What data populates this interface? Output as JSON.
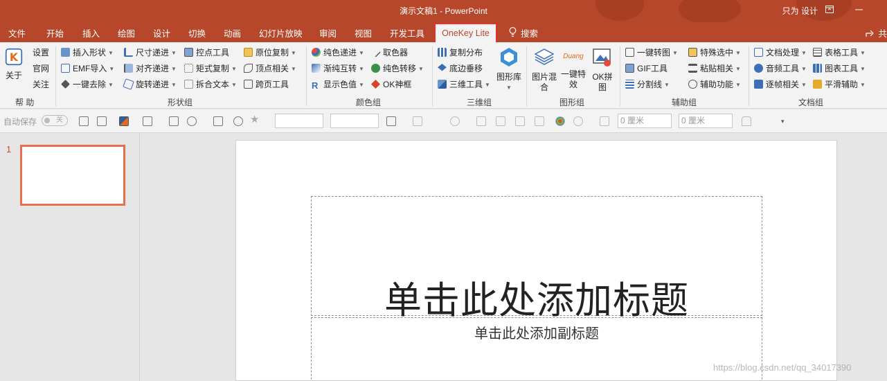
{
  "window": {
    "doc_title": "演示文稿1  -  PowerPoint",
    "user": "只为 设计"
  },
  "tabs": [
    "文件",
    "开始",
    "插入",
    "绘图",
    "设计",
    "切换",
    "动画",
    "幻灯片放映",
    "审阅",
    "视图",
    "开发工具"
  ],
  "active_tab": "OneKey Lite",
  "search_label": "搜索",
  "share_label": "共",
  "ribbon": {
    "help": {
      "about": "关于",
      "settings": "设置",
      "website": "官网",
      "follow": "关注",
      "group": "帮 助"
    },
    "shapes": {
      "items": [
        "插入形状",
        "EMF导入",
        "一键去除",
        "尺寸递进",
        "对齐递进",
        "旋转递进",
        "控点工具",
        "矩式复制",
        "拆合文本",
        "原位复制",
        "顶点相关",
        "跨页工具"
      ],
      "group": "形状组"
    },
    "color": {
      "items": [
        "纯色递进",
        "渐纯互转",
        "显示色值",
        "取色器",
        "纯色转移",
        "OK神框"
      ],
      "group": "颜色组"
    },
    "threed": {
      "items": [
        "复制分布",
        "底边垂移",
        "三维工具"
      ],
      "big": "图形库",
      "group": "三维组"
    },
    "graphics": {
      "mix": "图片混合",
      "effect": "一键特效",
      "okpin": "OK拼图",
      "duang": "Duang",
      "group": "图形组"
    },
    "assist": {
      "items": [
        "一键转图",
        "GIF工具",
        "分割线",
        "特殊选中",
        "粘贴相关",
        "辅助功能"
      ],
      "group": "辅助组"
    },
    "docs": {
      "items": [
        "文档处理",
        "音频工具",
        "逐帧相关",
        "表格工具",
        "图表工具",
        "平滑辅助"
      ],
      "group": "文档组"
    }
  },
  "toolbar": {
    "autosave": "自动保存",
    "toggle": "关",
    "field1": "0 厘米",
    "field2": "0 厘米"
  },
  "slides": {
    "number": "1"
  },
  "slide": {
    "title": "单击此处添加标题",
    "subtitle": "单击此处添加副标题"
  },
  "watermark": "https://blog.csdn.net/qq_34017390",
  "colors": {
    "accent": "#b7472a",
    "active_tab_border": "#e8302c",
    "thumb_border": "#e76e50"
  }
}
